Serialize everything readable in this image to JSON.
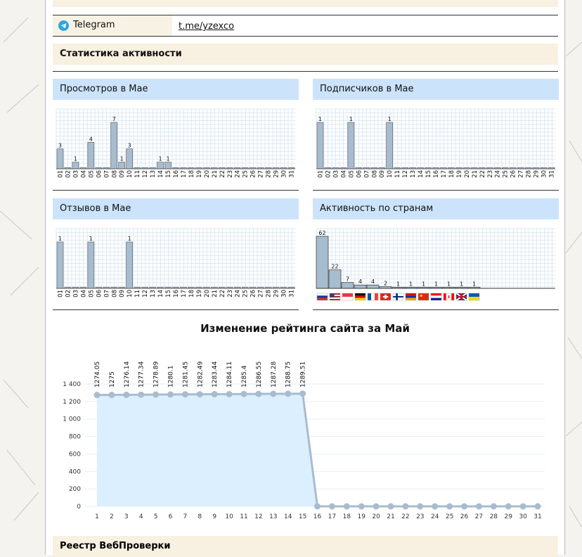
{
  "social": {
    "network": "Telegram",
    "link": "t.me/yzexco"
  },
  "sections": {
    "activity_title": "Статистика активности",
    "registry_title": "Реестр ВебПроверки"
  },
  "panels": {
    "views_title": "Просмотров в Мае",
    "subscribers_title": "Подписчиков в Мае",
    "reviews_title": "Отзывов в Мае",
    "countries_title": "Активность по странам"
  },
  "rating_title": "Изменение рейтинга сайта за Май",
  "chart_data": [
    {
      "type": "bar",
      "categories": [
        "01",
        "02",
        "03",
        "04",
        "05",
        "06",
        "07",
        "08",
        "09",
        "10",
        "11",
        "12",
        "13",
        "14",
        "15",
        "16",
        "17",
        "18",
        "19",
        "20",
        "21",
        "22",
        "23",
        "24",
        "25",
        "26",
        "27",
        "28",
        "29",
        "30",
        "31"
      ],
      "values": [
        3,
        0,
        1,
        0,
        4,
        0,
        0,
        7,
        1,
        3,
        0,
        0,
        0,
        1,
        1,
        0,
        0,
        0,
        0,
        0,
        0,
        0,
        0,
        0,
        0,
        0,
        0,
        0,
        0,
        0,
        0
      ]
    },
    {
      "type": "bar",
      "categories": [
        "01",
        "02",
        "03",
        "04",
        "05",
        "06",
        "07",
        "08",
        "09",
        "10",
        "11",
        "12",
        "13",
        "14",
        "15",
        "16",
        "17",
        "18",
        "19",
        "20",
        "21",
        "22",
        "23",
        "24",
        "25",
        "26",
        "27",
        "28",
        "29",
        "30",
        "31"
      ],
      "values": [
        1,
        0,
        0,
        0,
        1,
        0,
        0,
        0,
        0,
        1,
        0,
        0,
        0,
        0,
        0,
        0,
        0,
        0,
        0,
        0,
        0,
        0,
        0,
        0,
        0,
        0,
        0,
        0,
        0,
        0,
        0
      ]
    },
    {
      "type": "bar",
      "categories": [
        "01",
        "02",
        "03",
        "04",
        "05",
        "06",
        "07",
        "08",
        "09",
        "10",
        "11",
        "12",
        "13",
        "14",
        "15",
        "16",
        "17",
        "18",
        "19",
        "20",
        "21",
        "22",
        "23",
        "24",
        "25",
        "26",
        "27",
        "28",
        "29",
        "30",
        "31"
      ],
      "values": [
        1,
        0,
        0,
        0,
        1,
        0,
        0,
        0,
        0,
        1,
        0,
        0,
        0,
        0,
        0,
        0,
        0,
        0,
        0,
        0,
        0,
        0,
        0,
        0,
        0,
        0,
        0,
        0,
        0,
        0,
        0
      ]
    },
    {
      "type": "bar",
      "categories": [
        "ru",
        "us",
        "sg",
        "de",
        "fr",
        "ch",
        "fi",
        "am",
        "cn",
        "hr",
        "ca",
        "gb",
        "ua"
      ],
      "values": [
        62,
        22,
        7,
        4,
        4,
        2,
        1,
        1,
        1,
        1,
        1,
        1,
        1
      ]
    },
    {
      "type": "area",
      "x": [
        1,
        2,
        3,
        4,
        5,
        6,
        7,
        8,
        9,
        10,
        11,
        12,
        13,
        14,
        15,
        16,
        17,
        18,
        19,
        20,
        21,
        22,
        23,
        24,
        25,
        26,
        27,
        28,
        29,
        30,
        31
      ],
      "values": [
        1274.05,
        1275,
        1276.14,
        1277.34,
        1278.89,
        1280.1,
        1281.45,
        1282.49,
        1283.44,
        1284.11,
        1285.4,
        1286.55,
        1287.28,
        1288.75,
        1289.51,
        0,
        0,
        0,
        0,
        0,
        0,
        0,
        0,
        0,
        0,
        0,
        0,
        0,
        0,
        0,
        0
      ],
      "labels": [
        "1274.05",
        "1275",
        "1276.14",
        "1277.34",
        "1278.89",
        "1280.1",
        "1281.45",
        "1282.49",
        "1283.44",
        "1284.11",
        "1285.4",
        "1286.55",
        "1287.28",
        "1288.75",
        "1289.51"
      ],
      "yticks": [
        "0",
        "200",
        "400",
        "600",
        "800",
        "1 000",
        "1 200",
        "1 400"
      ],
      "ylim": [
        0,
        1400
      ]
    }
  ],
  "colors": {
    "bar": "#a8bccf",
    "panel_header": "#cce4fb",
    "section_header": "#f8f0e0",
    "area_fill": "#dcefff",
    "line": "#a8bccf"
  }
}
